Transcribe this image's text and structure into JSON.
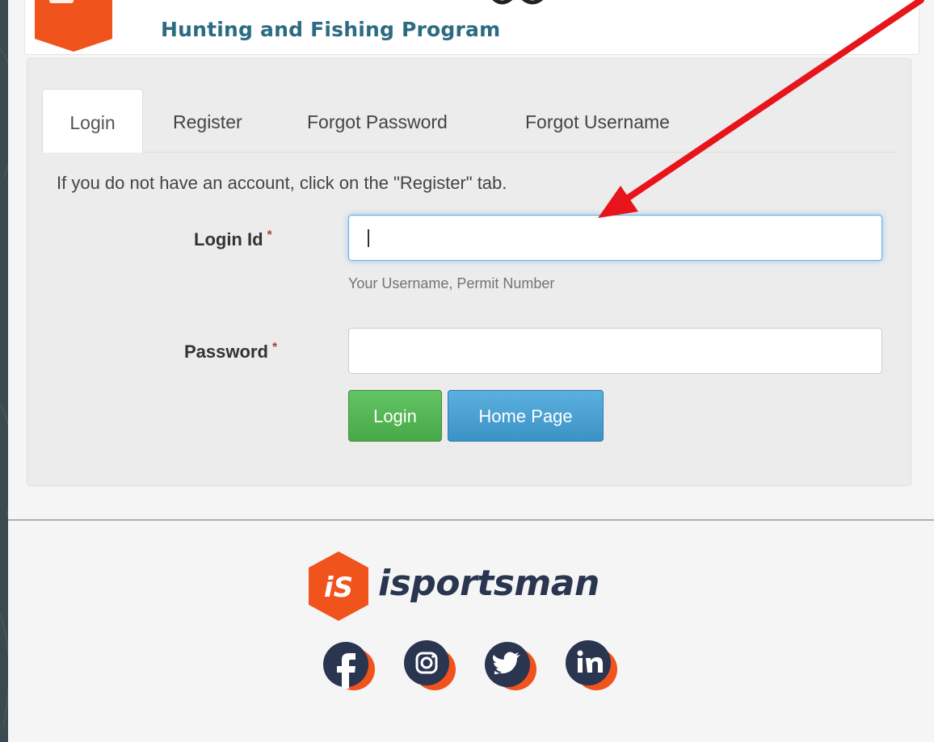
{
  "header": {
    "title": "Hunting and Fishing Program"
  },
  "tabs": [
    {
      "label": "Login",
      "active": true
    },
    {
      "label": "Register",
      "active": false
    },
    {
      "label": "Forgot Password",
      "active": false
    },
    {
      "label": "Forgot Username",
      "active": false
    }
  ],
  "form": {
    "intro": "If you do not have an account, click on the \"Register\" tab.",
    "login_id": {
      "label": "Login Id",
      "required_mark": "*",
      "value": "",
      "help": "Your Username, Permit Number"
    },
    "password": {
      "label": "Password",
      "required_mark": "*",
      "value": ""
    },
    "buttons": {
      "login": "Login",
      "home": "Home Page"
    }
  },
  "footer": {
    "brand_mark": "iS",
    "brand_name": "isportsman",
    "socials": [
      {
        "name": "facebook-icon",
        "glyph": "f"
      },
      {
        "name": "instagram-icon",
        "glyph": "ig"
      },
      {
        "name": "twitter-icon",
        "glyph": "tw"
      },
      {
        "name": "linkedin-icon",
        "glyph": "in"
      }
    ]
  },
  "colors": {
    "accent_orange": "#f0531c",
    "title_blue": "#2c6b82",
    "login_green": "#5cb85c",
    "home_blue": "#4aa3d6",
    "annotation_red": "#e8141c"
  }
}
